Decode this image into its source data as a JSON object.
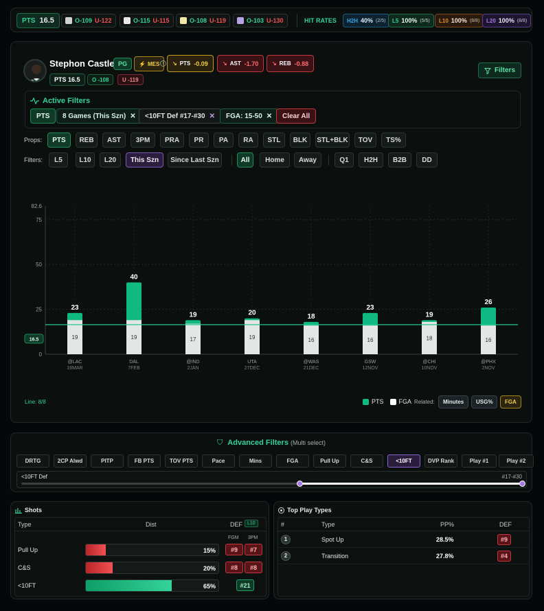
{
  "topbar": {
    "prop_label": "PTS",
    "prop_line": "16.5",
    "books": [
      {
        "over": "O-109",
        "under": "U-122",
        "icon": "book-icon"
      },
      {
        "over": "O-115",
        "under": "U-115",
        "icon": "book-icon"
      },
      {
        "over": "O-108",
        "under": "U-119",
        "icon": "book-icon"
      },
      {
        "over": "O-103",
        "under": "U-130",
        "icon": "book-icon"
      }
    ],
    "hit_rates_label": "HIT RATES",
    "hit_rates": [
      {
        "label": "H2H",
        "pct": "40%",
        "frac": "(2/5)",
        "color": "#3aa6e8"
      },
      {
        "label": "L5",
        "pct": "100%",
        "frac": "(5/5)",
        "color": "#34d399"
      },
      {
        "label": "L10",
        "pct": "100%",
        "frac": "(8/8)",
        "color": "#e08a2e"
      },
      {
        "label": "L20",
        "pct": "100%",
        "frac": "(8/8)",
        "color": "#a978e8"
      }
    ]
  },
  "player": {
    "name": "Stephon Castle",
    "position": "PG",
    "mes_label": "MES",
    "deltas": [
      {
        "label": "PTS",
        "value": "-0.09",
        "tone": "yellow"
      },
      {
        "label": "AST",
        "value": "-1.70",
        "tone": "red"
      },
      {
        "label": "REB",
        "value": "-0.88",
        "tone": "red"
      }
    ],
    "line_label": "PTS 16.5",
    "over_odds": "O -108",
    "under_odds": "U -119",
    "filters_button": "Filters"
  },
  "active_filters": {
    "title": "Active Filters",
    "chips": [
      "PTS",
      "8 Games (This Szn)",
      "<10FT Def #17-#30",
      "FGA: 15-50"
    ],
    "clear_label": "Clear All"
  },
  "props": {
    "label": "Props:",
    "items": [
      "PTS",
      "REB",
      "AST",
      "3PM",
      "PRA",
      "PR",
      "PA",
      "RA",
      "STL",
      "BLK",
      "STL+BLK",
      "TOV",
      "TS%"
    ],
    "selected": "PTS"
  },
  "filters_row": {
    "label": "Filters:",
    "range": [
      "L5",
      "L10",
      "L20",
      "This Szn",
      "Since Last Szn"
    ],
    "venue": [
      "All",
      "Home",
      "Away"
    ],
    "other": [
      "Q1",
      "H2H",
      "B2B",
      "DD"
    ]
  },
  "chart_data": {
    "type": "bar",
    "title": "",
    "ylim": [
      0,
      82.6
    ],
    "y_max_label": "82.6",
    "y_ticks": [
      0,
      25,
      50,
      75
    ],
    "line_value": 16.5,
    "line_label": "16.5",
    "categories": [
      {
        "opp": "@LAC",
        "date": "16MAR"
      },
      {
        "opp": "DAL",
        "date": "7FEB"
      },
      {
        "opp": "@IND",
        "date": "2JAN"
      },
      {
        "opp": "UTA",
        "date": "27DEC"
      },
      {
        "opp": "@WAS",
        "date": "21DEC"
      },
      {
        "opp": "GSW",
        "date": "12NOV"
      },
      {
        "opp": "@CHI",
        "date": "10NOV"
      },
      {
        "opp": "@PHX",
        "date": "2NOV"
      }
    ],
    "series": [
      {
        "name": "PTS",
        "values": [
          23,
          40,
          19,
          20,
          18,
          23,
          19,
          26
        ],
        "color": "#10b981"
      },
      {
        "name": "FGA",
        "values": [
          19,
          19,
          17,
          19,
          16,
          16,
          18,
          16
        ],
        "color": "#e4e6e5"
      }
    ],
    "hit_label": "Line: 8/8",
    "related_label": "Related:",
    "related": [
      "Minutes",
      "USG%",
      "FGA"
    ]
  },
  "advanced": {
    "title": "Advanced Filters",
    "subtitle": "(Multi select)",
    "buttons": [
      "DRTG",
      "2CP Alwd",
      "PITP",
      "FB PTS",
      "TOV PTS",
      "Pace",
      "Mins",
      "FGA",
      "Pull Up",
      "C&S",
      "<10FT",
      "DVP Rank",
      "Play #1",
      "Play #2"
    ],
    "selected": "<10FT",
    "slider_label": "<10FT Def",
    "slider_range": "#17-#30",
    "slider_low_fraction": 0.555,
    "slider_high_fraction": 1.0
  },
  "shots": {
    "title": "Shots",
    "col_type": "Type",
    "col_dist": "Dist",
    "col_def": "DEF",
    "def_badge": "L10",
    "sub_fgm": "FGM",
    "sub_3pm": "3PM",
    "rows": [
      {
        "type": "Pull Up",
        "pct": "15%",
        "fill": 0.15,
        "fgm": "#9",
        "tpm": "#7",
        "color": "red"
      },
      {
        "type": "C&S",
        "pct": "20%",
        "fill": 0.2,
        "fgm": "#8",
        "tpm": "#8",
        "color": "red"
      },
      {
        "type": "<10FT",
        "pct": "65%",
        "fill": 0.65,
        "fgm": "#21",
        "tpm": "",
        "color": "green"
      }
    ]
  },
  "plays": {
    "title": "Top Play Types",
    "col_num": "#",
    "col_type": "Type",
    "col_pp": "PP%",
    "col_def": "DEF",
    "rows": [
      {
        "num": "1",
        "type": "Spot Up",
        "pp": "28.5%",
        "def": "#9"
      },
      {
        "num": "2",
        "type": "Transition",
        "pp": "27.8%",
        "def": "#4"
      }
    ]
  }
}
